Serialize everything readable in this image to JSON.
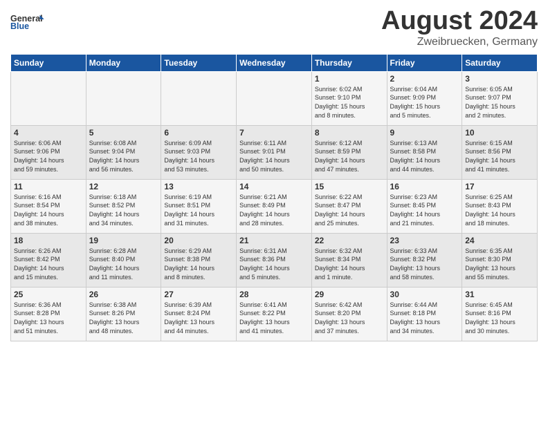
{
  "header": {
    "logo_line1": "General",
    "logo_line2": "Blue",
    "title": "August 2024",
    "subtitle": "Zweibruecken, Germany"
  },
  "columns": [
    "Sunday",
    "Monday",
    "Tuesday",
    "Wednesday",
    "Thursday",
    "Friday",
    "Saturday"
  ],
  "weeks": [
    [
      {
        "day": "",
        "info": ""
      },
      {
        "day": "",
        "info": ""
      },
      {
        "day": "",
        "info": ""
      },
      {
        "day": "",
        "info": ""
      },
      {
        "day": "1",
        "info": "Sunrise: 6:02 AM\nSunset: 9:10 PM\nDaylight: 15 hours\nand 8 minutes."
      },
      {
        "day": "2",
        "info": "Sunrise: 6:04 AM\nSunset: 9:09 PM\nDaylight: 15 hours\nand 5 minutes."
      },
      {
        "day": "3",
        "info": "Sunrise: 6:05 AM\nSunset: 9:07 PM\nDaylight: 15 hours\nand 2 minutes."
      }
    ],
    [
      {
        "day": "4",
        "info": "Sunrise: 6:06 AM\nSunset: 9:06 PM\nDaylight: 14 hours\nand 59 minutes."
      },
      {
        "day": "5",
        "info": "Sunrise: 6:08 AM\nSunset: 9:04 PM\nDaylight: 14 hours\nand 56 minutes."
      },
      {
        "day": "6",
        "info": "Sunrise: 6:09 AM\nSunset: 9:03 PM\nDaylight: 14 hours\nand 53 minutes."
      },
      {
        "day": "7",
        "info": "Sunrise: 6:11 AM\nSunset: 9:01 PM\nDaylight: 14 hours\nand 50 minutes."
      },
      {
        "day": "8",
        "info": "Sunrise: 6:12 AM\nSunset: 8:59 PM\nDaylight: 14 hours\nand 47 minutes."
      },
      {
        "day": "9",
        "info": "Sunrise: 6:13 AM\nSunset: 8:58 PM\nDaylight: 14 hours\nand 44 minutes."
      },
      {
        "day": "10",
        "info": "Sunrise: 6:15 AM\nSunset: 8:56 PM\nDaylight: 14 hours\nand 41 minutes."
      }
    ],
    [
      {
        "day": "11",
        "info": "Sunrise: 6:16 AM\nSunset: 8:54 PM\nDaylight: 14 hours\nand 38 minutes."
      },
      {
        "day": "12",
        "info": "Sunrise: 6:18 AM\nSunset: 8:52 PM\nDaylight: 14 hours\nand 34 minutes."
      },
      {
        "day": "13",
        "info": "Sunrise: 6:19 AM\nSunset: 8:51 PM\nDaylight: 14 hours\nand 31 minutes."
      },
      {
        "day": "14",
        "info": "Sunrise: 6:21 AM\nSunset: 8:49 PM\nDaylight: 14 hours\nand 28 minutes."
      },
      {
        "day": "15",
        "info": "Sunrise: 6:22 AM\nSunset: 8:47 PM\nDaylight: 14 hours\nand 25 minutes."
      },
      {
        "day": "16",
        "info": "Sunrise: 6:23 AM\nSunset: 8:45 PM\nDaylight: 14 hours\nand 21 minutes."
      },
      {
        "day": "17",
        "info": "Sunrise: 6:25 AM\nSunset: 8:43 PM\nDaylight: 14 hours\nand 18 minutes."
      }
    ],
    [
      {
        "day": "18",
        "info": "Sunrise: 6:26 AM\nSunset: 8:42 PM\nDaylight: 14 hours\nand 15 minutes."
      },
      {
        "day": "19",
        "info": "Sunrise: 6:28 AM\nSunset: 8:40 PM\nDaylight: 14 hours\nand 11 minutes."
      },
      {
        "day": "20",
        "info": "Sunrise: 6:29 AM\nSunset: 8:38 PM\nDaylight: 14 hours\nand 8 minutes."
      },
      {
        "day": "21",
        "info": "Sunrise: 6:31 AM\nSunset: 8:36 PM\nDaylight: 14 hours\nand 5 minutes."
      },
      {
        "day": "22",
        "info": "Sunrise: 6:32 AM\nSunset: 8:34 PM\nDaylight: 14 hours\nand 1 minute."
      },
      {
        "day": "23",
        "info": "Sunrise: 6:33 AM\nSunset: 8:32 PM\nDaylight: 13 hours\nand 58 minutes."
      },
      {
        "day": "24",
        "info": "Sunrise: 6:35 AM\nSunset: 8:30 PM\nDaylight: 13 hours\nand 55 minutes."
      }
    ],
    [
      {
        "day": "25",
        "info": "Sunrise: 6:36 AM\nSunset: 8:28 PM\nDaylight: 13 hours\nand 51 minutes."
      },
      {
        "day": "26",
        "info": "Sunrise: 6:38 AM\nSunset: 8:26 PM\nDaylight: 13 hours\nand 48 minutes."
      },
      {
        "day": "27",
        "info": "Sunrise: 6:39 AM\nSunset: 8:24 PM\nDaylight: 13 hours\nand 44 minutes."
      },
      {
        "day": "28",
        "info": "Sunrise: 6:41 AM\nSunset: 8:22 PM\nDaylight: 13 hours\nand 41 minutes."
      },
      {
        "day": "29",
        "info": "Sunrise: 6:42 AM\nSunset: 8:20 PM\nDaylight: 13 hours\nand 37 minutes."
      },
      {
        "day": "30",
        "info": "Sunrise: 6:44 AM\nSunset: 8:18 PM\nDaylight: 13 hours\nand 34 minutes."
      },
      {
        "day": "31",
        "info": "Sunrise: 6:45 AM\nSunset: 8:16 PM\nDaylight: 13 hours\nand 30 minutes."
      }
    ]
  ]
}
